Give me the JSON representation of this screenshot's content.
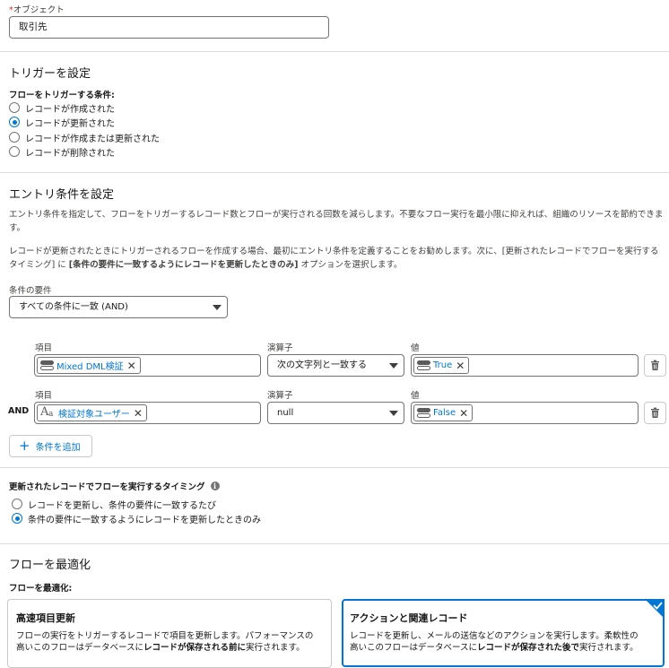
{
  "object_field": {
    "required_mark": "*",
    "label": "オブジェクト",
    "value": "取引先"
  },
  "trigger": {
    "title": "トリガーを設定",
    "condition_label": "フローをトリガーする条件:",
    "options": [
      {
        "label": "レコードが作成された",
        "checked": false
      },
      {
        "label": "レコードが更新された",
        "checked": true
      },
      {
        "label": "レコードが作成または更新された",
        "checked": false
      },
      {
        "label": "レコードが削除された",
        "checked": false
      }
    ]
  },
  "entry": {
    "title": "エントリ条件を設定",
    "para1": "エントリ条件を指定して、フローをトリガーするレコード数とフローが実行される回数を減らします。不要なフロー実行を最小限に抑えれば、組織のリソースを節約できます。",
    "para2_a": "レコードが更新されたときにトリガーされるフローを作成する場合、最初にエントリ条件を定義することをお勧めします。次に、[更新されたレコードでフローを実行するタイミング] に ",
    "para2_b": "[条件の要件に一致するようにレコードを更新したときのみ]",
    "para2_c": " オプションを選択します。",
    "requirement_label": "条件の要件",
    "requirement_value": "すべての条件に一致 (AND)",
    "col_field": "項目",
    "col_operator": "演算子",
    "col_value": "値",
    "conditions": [
      {
        "prefix": "",
        "field": "Mixed DML検証",
        "field_icon": "toggle-icon",
        "operator": "次の文字列と一致する",
        "value": "True"
      },
      {
        "prefix": "AND",
        "field": "検証対象ユーザー",
        "field_icon": "text-icon",
        "operator": "null",
        "value": "False"
      }
    ],
    "add_condition_label": "条件を追加"
  },
  "timing": {
    "title": "更新されたレコードでフローを実行するタイミング",
    "options": [
      {
        "label": "レコードを更新し、条件の要件に一致するたび",
        "checked": false
      },
      {
        "label": "条件の要件に一致するようにレコードを更新したときのみ",
        "checked": true
      }
    ]
  },
  "optimize": {
    "title": "フローを最適化",
    "label": "フローを最適化:",
    "cards": [
      {
        "title": "高速項目更新",
        "desc_a": "フローの実行をトリガーするレコードで項目を更新します。パフォーマンスの高いこのフローはデータベースに",
        "desc_b": "レコードが保存される前に",
        "desc_c": "実行されます。",
        "selected": false
      },
      {
        "title": "アクションと関連レコード",
        "desc_a": "レコードを更新し、メールの送信などのアクションを実行します。柔軟性の高いこのフローはデータベースに",
        "desc_b": "レコードが保存された後で",
        "desc_c": "実行されます。",
        "selected": true
      }
    ]
  },
  "colors": {
    "brand": "#0176d3",
    "border": "#747474",
    "divider": "#dddbda"
  }
}
